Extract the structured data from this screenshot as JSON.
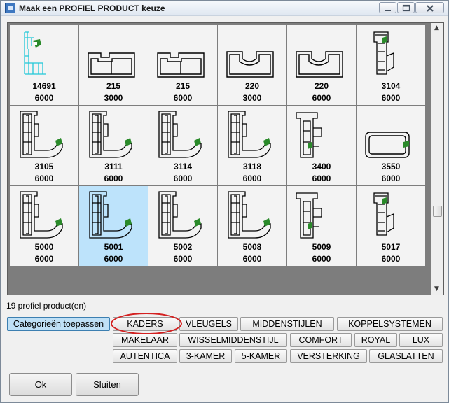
{
  "window": {
    "title": "Maak een PROFIEL PRODUCT keuze",
    "controls": [
      "minimize-icon",
      "maximize-icon",
      "close-icon"
    ]
  },
  "products": [
    {
      "code": "14691",
      "length": "6000",
      "icon": "profile-cyan-icon"
    },
    {
      "code": "215",
      "length": "3000",
      "icon": "profile-double-box-icon"
    },
    {
      "code": "215",
      "length": "6000",
      "icon": "profile-double-box-icon"
    },
    {
      "code": "220",
      "length": "3000",
      "icon": "profile-notch-box-icon"
    },
    {
      "code": "220",
      "length": "6000",
      "icon": "profile-notch-box-icon"
    },
    {
      "code": "3104",
      "length": "6000",
      "icon": "profile-vertical-icon"
    },
    {
      "code": "3105",
      "length": "6000",
      "icon": "profile-frame-icon"
    },
    {
      "code": "3111",
      "length": "6000",
      "icon": "profile-frame-icon"
    },
    {
      "code": "3114",
      "length": "6000",
      "icon": "profile-frame-icon"
    },
    {
      "code": "3118",
      "length": "6000",
      "icon": "profile-frame-icon"
    },
    {
      "code": "3400",
      "length": "6000",
      "icon": "profile-t-icon"
    },
    {
      "code": "3550",
      "length": "6000",
      "icon": "profile-rect-icon"
    },
    {
      "code": "5000",
      "length": "6000",
      "icon": "profile-frame-icon"
    },
    {
      "code": "5001",
      "length": "6000",
      "icon": "profile-frame-icon",
      "selected": true
    },
    {
      "code": "5002",
      "length": "6000",
      "icon": "profile-frame-icon"
    },
    {
      "code": "5008",
      "length": "6000",
      "icon": "profile-frame-icon"
    },
    {
      "code": "5009",
      "length": "6000",
      "icon": "profile-t-icon"
    },
    {
      "code": "5017",
      "length": "6000",
      "icon": "profile-vertical-icon"
    }
  ],
  "status": {
    "count_label": "19 profiel product(en)"
  },
  "apply_button": "Categorieën toepassen",
  "categories": {
    "row1": [
      "KADERS",
      "VLEUGELS",
      "MIDDENSTIJLEN",
      "KOPPELSYSTEMEN"
    ],
    "row2": [
      "MAKELAAR",
      "WISSELMIDDENSTIJL",
      "COMFORT",
      "ROYAL",
      "LUX"
    ],
    "row3": [
      "AUTENTICA",
      "3-KAMER",
      "5-KAMER",
      "VERSTERKING",
      "GLASLATTEN"
    ]
  },
  "buttons": {
    "ok": "Ok",
    "close": "Sluiten"
  },
  "colors": {
    "selected_cell": "#bde3fb",
    "apply_button": "#bfe0f6",
    "highlight": "#d42020",
    "accent_green": "#2a8a2a",
    "accent_cyan": "#20c8d8"
  }
}
